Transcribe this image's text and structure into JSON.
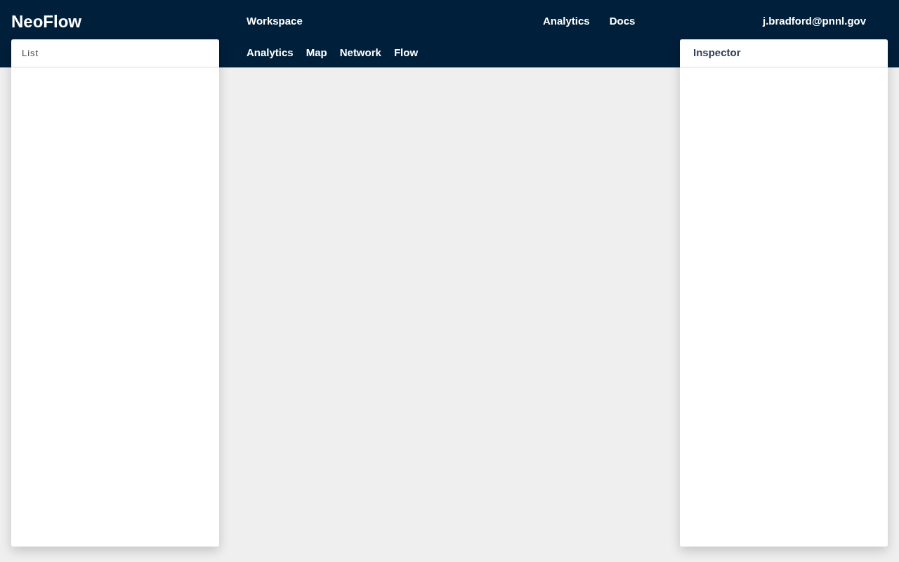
{
  "header": {
    "brand": "NeoFlow",
    "primary_nav": [
      "Workspace"
    ],
    "right_nav": [
      "Analytics",
      "Docs"
    ],
    "user": "j.bradford@pnnl.gov",
    "secondary_nav": [
      "Analytics",
      "Map",
      "Network",
      "Flow"
    ]
  },
  "left_panel": {
    "title": "List"
  },
  "right_panel": {
    "title": "Inspector"
  }
}
